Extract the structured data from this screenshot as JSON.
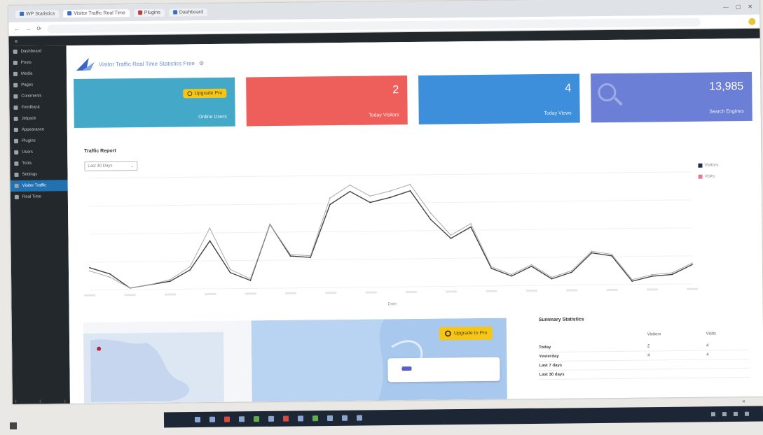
{
  "browser": {
    "tabs": [
      {
        "label": "WP Statistics",
        "active": false
      },
      {
        "label": "Visitor Traffic Real Time",
        "active": true
      },
      {
        "label": "Plugins",
        "active": false
      },
      {
        "label": "Dashboard",
        "active": false
      }
    ],
    "url": ""
  },
  "admin_bar": {
    "site": "",
    "right": ""
  },
  "sidebar": {
    "items": [
      {
        "label": "Dashboard"
      },
      {
        "label": "Posts"
      },
      {
        "label": "Media"
      },
      {
        "label": "Pages"
      },
      {
        "label": "Comments"
      },
      {
        "label": "Feedback"
      },
      {
        "label": "Jetpack"
      },
      {
        "label": "Appearance"
      },
      {
        "label": "Plugins"
      },
      {
        "label": "Users"
      },
      {
        "label": "Tools"
      },
      {
        "label": "Settings"
      },
      {
        "label": "Visitor Traffic"
      },
      {
        "label": "Real Time"
      }
    ],
    "active_label": "Visitor Traffic"
  },
  "header": {
    "title": "Visitor Traffic Real Time Statistics Free"
  },
  "stats": [
    {
      "value": "",
      "label": "Online Users",
      "pill": "Upgrade Pro",
      "color": "#44a9c9"
    },
    {
      "value": "2",
      "label": "Today Visitors",
      "color": "#ee5f5b"
    },
    {
      "value": "4",
      "label": "Today Views",
      "color": "#3e8fdb"
    },
    {
      "value": "13,985",
      "label": "Search Engines",
      "color": "#6c7fd6"
    }
  ],
  "traffic": {
    "title": "Traffic Report",
    "select_value": "Last 30 Days",
    "legend": [
      {
        "name": "Visitors",
        "color": "#1f2d4d"
      },
      {
        "name": "Visits",
        "color": "#e07d96"
      }
    ],
    "xlabel": "Date"
  },
  "chart_data": {
    "type": "line",
    "x": [
      "1",
      "2",
      "3",
      "4",
      "5",
      "6",
      "7",
      "8",
      "9",
      "10",
      "11",
      "12",
      "13",
      "14",
      "15",
      "16",
      "17",
      "18",
      "19",
      "20",
      "21",
      "22",
      "23",
      "24",
      "25",
      "26",
      "27",
      "28",
      "29",
      "30",
      "31",
      "32",
      "33",
      "34",
      "35"
    ],
    "series": [
      {
        "name": "Visitors",
        "values": [
          14,
          10,
          1,
          3,
          5,
          12,
          30,
          10,
          5,
          40,
          20,
          19,
          52,
          60,
          53,
          56,
          60,
          42,
          30,
          37,
          11,
          6,
          12,
          4,
          8,
          20,
          18,
          2,
          5,
          6,
          12
        ]
      },
      {
        "name": "Visits",
        "values": [
          12,
          8,
          1,
          3,
          6,
          14,
          38,
          12,
          6,
          40,
          21,
          20,
          56,
          64,
          57,
          60,
          64,
          46,
          32,
          39,
          12,
          7,
          13,
          5,
          9,
          21,
          19,
          3,
          6,
          7,
          13
        ]
      }
    ],
    "ylim": [
      0,
      70
    ]
  },
  "map": {
    "upgrade_label": "Upgrade to Pro"
  },
  "summary": {
    "title": "Summary Statistics",
    "columns": [
      "",
      "Visitors",
      "Visits"
    ],
    "rows": [
      {
        "label": "Today",
        "visitors": "2",
        "visits": "4"
      },
      {
        "label": "Yesterday",
        "visitors": "4",
        "visits": "4"
      },
      {
        "label": "Last 7 days",
        "visitors": "",
        "visits": ""
      },
      {
        "label": "Last 30 days",
        "visitors": "",
        "visits": ""
      }
    ]
  },
  "footer": {
    "label": ""
  }
}
